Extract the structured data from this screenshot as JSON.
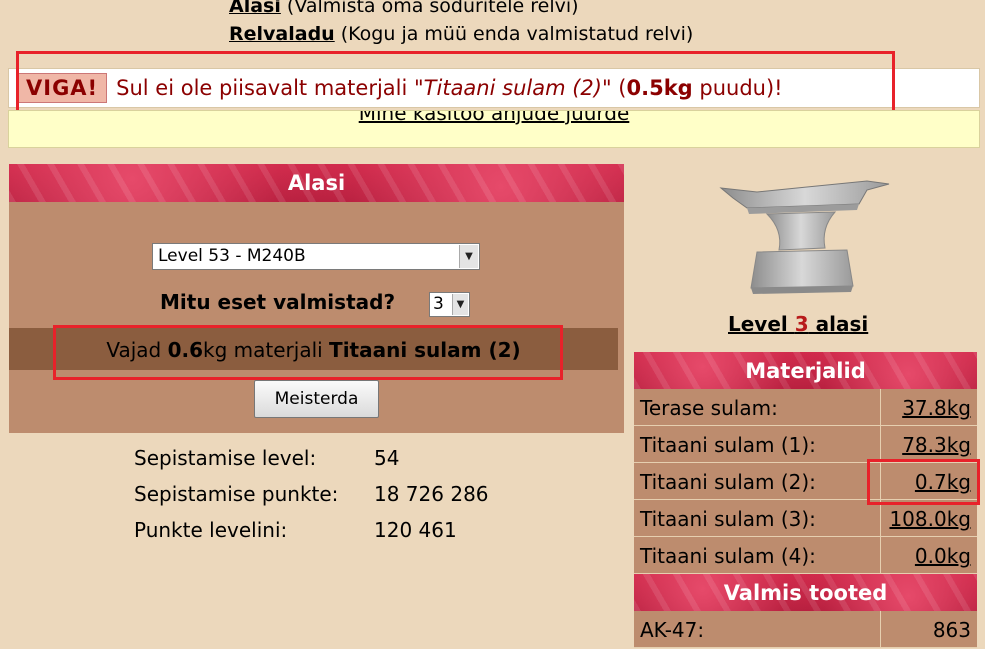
{
  "top_links": [
    {
      "label": "Alasi",
      "desc": "(Valmista oma sõduritele relvi)"
    },
    {
      "label": "Relvaladu",
      "desc": "(Kogu ja müü enda valmistatud relvi)"
    }
  ],
  "error": {
    "badge": "VIGA!",
    "prefix": "Sul ei ole piisavalt materjali \"",
    "material": "Titaani sulam (2)",
    "mid": "\" (",
    "amount": "0.5kg",
    "suffix": " puudu)!"
  },
  "link_back": "Mine kasitöö ahjude juurde",
  "alasi": {
    "title": "Alasi",
    "selected_item": "Level 53 - M240B",
    "count_label": "Mitu eset valmistad?",
    "count_value": "3",
    "need_prefix": "Vajad ",
    "need_amount": "0.6",
    "need_mid": "kg materjali ",
    "need_material": "Titaani sulam (2)",
    "craft_button": "Meisterda"
  },
  "stats": [
    {
      "label": "Sepistamise level:",
      "value": "54"
    },
    {
      "label": "Sepistamise punkte:",
      "value": "18 726 286"
    },
    {
      "label": "Punkte levelini:",
      "value": "120 461"
    }
  ],
  "anvil_level": {
    "prefix": "Level ",
    "num": "3",
    "suffix": " alasi"
  },
  "materials": {
    "title": "Materjalid",
    "rows": [
      {
        "name": "Terase sulam:",
        "value": "37.8kg"
      },
      {
        "name": "Titaani sulam (1):",
        "value": "78.3kg"
      },
      {
        "name": "Titaani sulam (2):",
        "value": "0.7kg"
      },
      {
        "name": "Titaani sulam (3):",
        "value": "108.0kg"
      },
      {
        "name": "Titaani sulam (4):",
        "value": "0.0kg"
      }
    ]
  },
  "products": {
    "title": "Valmis tooted",
    "rows": [
      {
        "name": "AK-47:",
        "value": "863"
      }
    ]
  },
  "colors": {
    "page_bg": "#ecd8bc",
    "panel": "#bd8c6e",
    "panel_dark": "#8b5d3f",
    "banner": "#b81838",
    "error_text": "#8b0000",
    "highlight_box": "#e8222a",
    "yellow_bar": "#ffffc8"
  }
}
